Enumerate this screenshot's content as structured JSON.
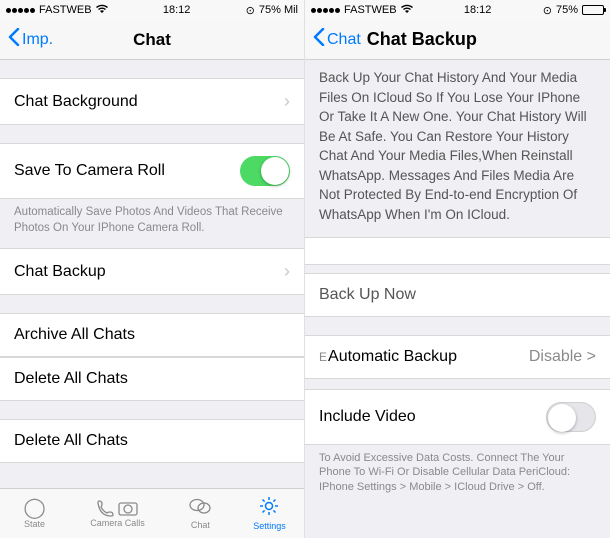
{
  "status": {
    "carrier": "FASTWEB",
    "time": "18:12",
    "battery_text_left": "75% Mil",
    "battery_text_right": "75%"
  },
  "left": {
    "nav_back_label": "Imp.",
    "nav_title": "Chat",
    "chat_background": "Chat Background",
    "save_camera_roll": "Save To Camera Roll",
    "save_camera_roll_footnote": "Automatically Save Photos And Videos That Receive Photos On Your IPhone Camera Roll.",
    "chat_backup": "Chat Backup",
    "archive_all": "Archive All Chats",
    "delete_all_1": "Delete All Chats",
    "delete_all_2": "Delete All Chats"
  },
  "tabbar": {
    "state": "State",
    "camera_calls": "Camera Calls",
    "chat": "Chat",
    "settings": "Settings"
  },
  "right": {
    "nav_back_label": "Chat",
    "nav_title": "Chat Backup",
    "body_text": "Back Up Your Chat History And Your Media Files On ICloud So If You Lose Your IPhone Or Take It A New One. Your Chat History Will Be At Safe. You Can Restore Your History Chat And Your Media Files,When Reinstall WhatsApp. Messages And Files Media Are Not Protected By End-to-end Encryption Of WhatsApp When I'm On ICloud.",
    "backup_now": "Back Up Now",
    "auto_backup_prefix": "E",
    "auto_backup_label": "Automatic Backup",
    "auto_backup_value": "Disable >",
    "include_video": "Include Video",
    "footer_text": "To Avoid Excessive Data Costs. Connect The Your Phone To Wi-Fi Or Disable Cellular Data PeriCloud: IPhone Settings > Mobile > ICloud Drive > Off."
  }
}
